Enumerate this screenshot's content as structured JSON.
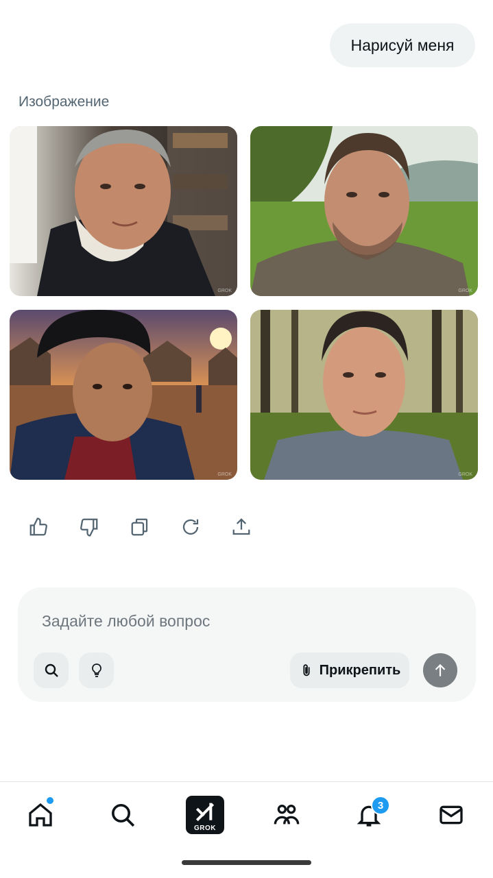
{
  "chat": {
    "user_message": "Нарисуй меня",
    "section_label": "Изображение"
  },
  "images": [
    {
      "label": "portrait-1"
    },
    {
      "label": "portrait-2"
    },
    {
      "label": "portrait-3"
    },
    {
      "label": "portrait-4"
    }
  ],
  "actions": [
    "thumbs-up-icon",
    "thumbs-down-icon",
    "copy-icon",
    "regenerate-icon",
    "share-icon"
  ],
  "composer": {
    "placeholder": "Задайте любой вопрос",
    "attach_label": "Прикрепить"
  },
  "nav": {
    "items": [
      "home-icon",
      "search-icon",
      "grok-icon",
      "communities-icon",
      "notifications-icon",
      "messages-icon"
    ],
    "grok_label": "GROK",
    "notifications_count": "3"
  },
  "colors": {
    "accent": "#1d9bf0",
    "bubble": "#eff3f4",
    "composer_bg": "#f5f7f7",
    "send_button": "#7a7f83"
  }
}
